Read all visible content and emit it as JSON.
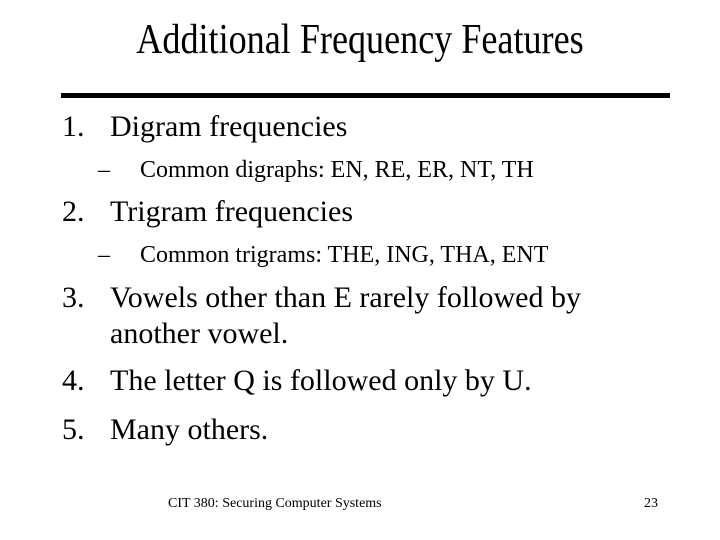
{
  "slide": {
    "title": "Additional Frequency Features",
    "items": [
      {
        "number": "1.",
        "text": "Digram frequencies",
        "sub": {
          "dash": "–",
          "text": "Common digraphs: EN, RE, ER, NT, TH"
        }
      },
      {
        "number": "2.",
        "text": "Trigram frequencies",
        "sub": {
          "dash": "–",
          "text": "Common trigrams: THE, ING, THA, ENT"
        }
      },
      {
        "number": "3.",
        "text": "Vowels other than E rarely followed by",
        "continuation": "another vowel."
      },
      {
        "number": "4.",
        "text": "The letter Q is followed only by U."
      },
      {
        "number": "5.",
        "text": "Many others."
      }
    ],
    "footer": {
      "course": "CIT 380: Securing Computer Systems",
      "page_number": "23"
    }
  }
}
